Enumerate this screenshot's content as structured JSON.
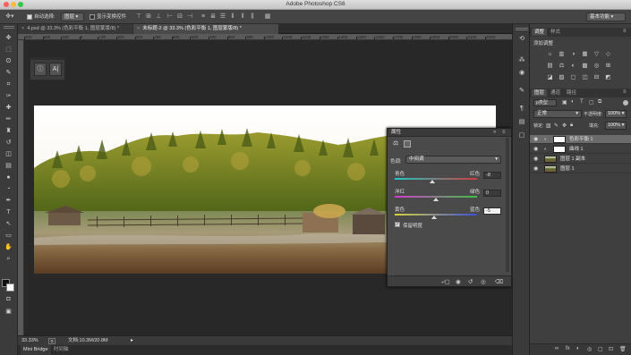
{
  "app": {
    "title": "Adobe Photoshop CS6"
  },
  "colors": {
    "foreground": "#111111",
    "background": "#ffffff",
    "accent_highlight": "#6b6b6b"
  },
  "options_bar": {
    "move_tool_icon": "move-tool-icon",
    "auto_select_label": "自动选择:",
    "auto_select_value": "图层",
    "show_transform_label": "显示变换控件",
    "workspace_value": "基本功能"
  },
  "toolbar": {
    "tools": [
      "move",
      "marquee",
      "lasso",
      "quick-select",
      "crop",
      "eyedropper",
      "healing",
      "brush",
      "clone-stamp",
      "history-brush",
      "eraser",
      "gradient",
      "blur",
      "dodge",
      "pen",
      "type",
      "path-select",
      "shape",
      "hand",
      "zoom"
    ],
    "glyphs": [
      "✥",
      "⬚",
      "ʘ",
      "✎",
      "⌗",
      "✑",
      "✚",
      "✏",
      "♜",
      "↺",
      "◫",
      "▤",
      "●",
      "◔",
      "✒",
      "T",
      "↖",
      "▭",
      "✋",
      "⌕"
    ]
  },
  "tabs": [
    {
      "label": "4.psd @ 33.3% (色彩平衡 1, 图层蒙版/8) *"
    },
    {
      "label": "未标题-2 @ 33.3% (色彩平衡 1, 图层蒙版/8) *"
    }
  ],
  "ruler": {
    "ticks": [
      "300",
      "200",
      "100",
      "0",
      "100",
      "200",
      "300",
      "400",
      "500",
      "600",
      "700",
      "800",
      "900",
      "1000",
      "1100",
      "1200",
      "1300",
      "1400",
      "1500",
      "1600",
      "1700",
      "1800",
      "1900",
      "2000",
      "2100",
      "2200"
    ]
  },
  "mini_panel": {
    "info_glyph": "i",
    "char_glyph": "A|"
  },
  "properties": {
    "title": "属性",
    "tone_label": "色调:",
    "tone_value": "中间调",
    "sliders": [
      {
        "left": "青色",
        "right": "红色",
        "value": "-8",
        "fraction": 0.46
      },
      {
        "left": "洋红",
        "right": "绿色",
        "value": "0",
        "fraction": 0.5
      },
      {
        "left": "黄色",
        "right": "蓝色",
        "value": "-5",
        "fraction": 0.475
      }
    ],
    "preserve_luminosity": "保留明度"
  },
  "status": {
    "zoom": "33.33%",
    "doc": "文档:10.3M/20.8M",
    "bridge_tab": "Mini Bridge",
    "timeline_tab": "时间轴"
  },
  "adjustments": {
    "tab_adjust": "调整",
    "tab_styles": "样式",
    "add_label": "添加调整",
    "icons": [
      "☼",
      "▥",
      "◑",
      "▦",
      "▽",
      "◇",
      "▤",
      "⚖",
      "◐",
      "▩",
      "◎",
      "⊞",
      "◪",
      "▨",
      "▢",
      "◫",
      "⊟",
      "◩"
    ]
  },
  "layers": {
    "tab_layers": "图层",
    "tab_channels": "通道",
    "tab_paths": "路径",
    "kind": "ρ类型",
    "blend_mode": "正常",
    "opacity_label": "不透明度:",
    "opacity_value": "100%",
    "lock_label": "锁定:",
    "fill_label": "填充:",
    "fill_value": "100%",
    "rows": [
      {
        "name": "色彩平衡 1"
      },
      {
        "name": "曲线 1"
      },
      {
        "name": "图层 1 副本"
      },
      {
        "name": "图层 1"
      }
    ],
    "footer_icons": [
      "∞",
      "fx",
      "◐",
      "◎",
      "▢",
      "⊡",
      "🗑"
    ]
  }
}
